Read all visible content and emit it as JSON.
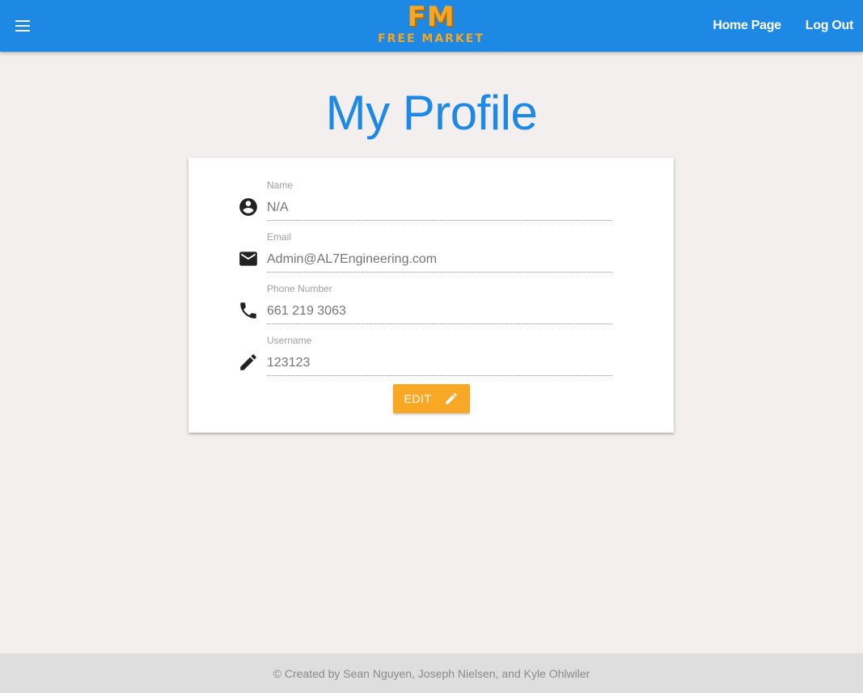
{
  "navbar": {
    "logo_mark": "FM",
    "logo_text": "FREE MARKET",
    "links": [
      "Home Page",
      "Log Out"
    ],
    "menu_icon": "hamburger-menu-icon",
    "color": "#1e88e5"
  },
  "page": {
    "title": "My Profile"
  },
  "profile": {
    "fields": [
      {
        "label": "Name",
        "value": "N/A",
        "icon": "account-circle-icon"
      },
      {
        "label": "Email",
        "value": "Admin@AL7Engineering.com",
        "icon": "email-icon"
      },
      {
        "label": "Phone Number",
        "value": "661 219 3063",
        "icon": "phone-icon"
      },
      {
        "label": "Username",
        "value": "123123",
        "icon": "pencil-icon"
      }
    ],
    "edit_button": {
      "label": "EDIT",
      "icon": "pencil-icon",
      "color": "#f9a825"
    }
  },
  "footer": {
    "text": "© Created by Sean Nguyen, Joseph Nielsen, and Kyle Ohlwiler"
  }
}
